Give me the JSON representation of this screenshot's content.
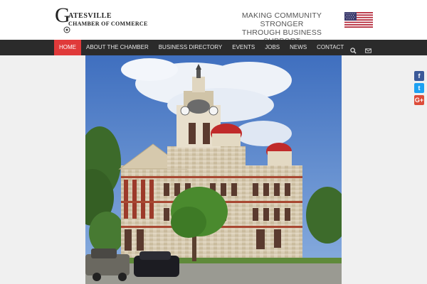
{
  "logo": {
    "initial": "G",
    "line1": "ATESVILLE",
    "line2": "CHAMBER OF COMMERCE"
  },
  "tagline": {
    "line1": "MAKING COMMUNITY STRONGER",
    "line2": "THROUGH BUSINESS SUPPORT"
  },
  "nav": {
    "items": [
      {
        "label": "HOME",
        "active": true
      },
      {
        "label": "ABOUT THE CHAMBER"
      },
      {
        "label": "BUSINESS DIRECTORY"
      },
      {
        "label": "EVENTS"
      },
      {
        "label": "JOBS"
      },
      {
        "label": "NEWS"
      },
      {
        "label": "CONTACT"
      }
    ],
    "icons": [
      "search-icon",
      "mail-icon"
    ]
  },
  "hero": {
    "subject": "courthouse-photo"
  },
  "social": {
    "facebook": "f",
    "twitter": "t",
    "googleplus": "G+"
  },
  "colors": {
    "nav_bg": "#2b2b2b",
    "nav_active": "#e03a3a",
    "sky": "#5b86c9"
  }
}
